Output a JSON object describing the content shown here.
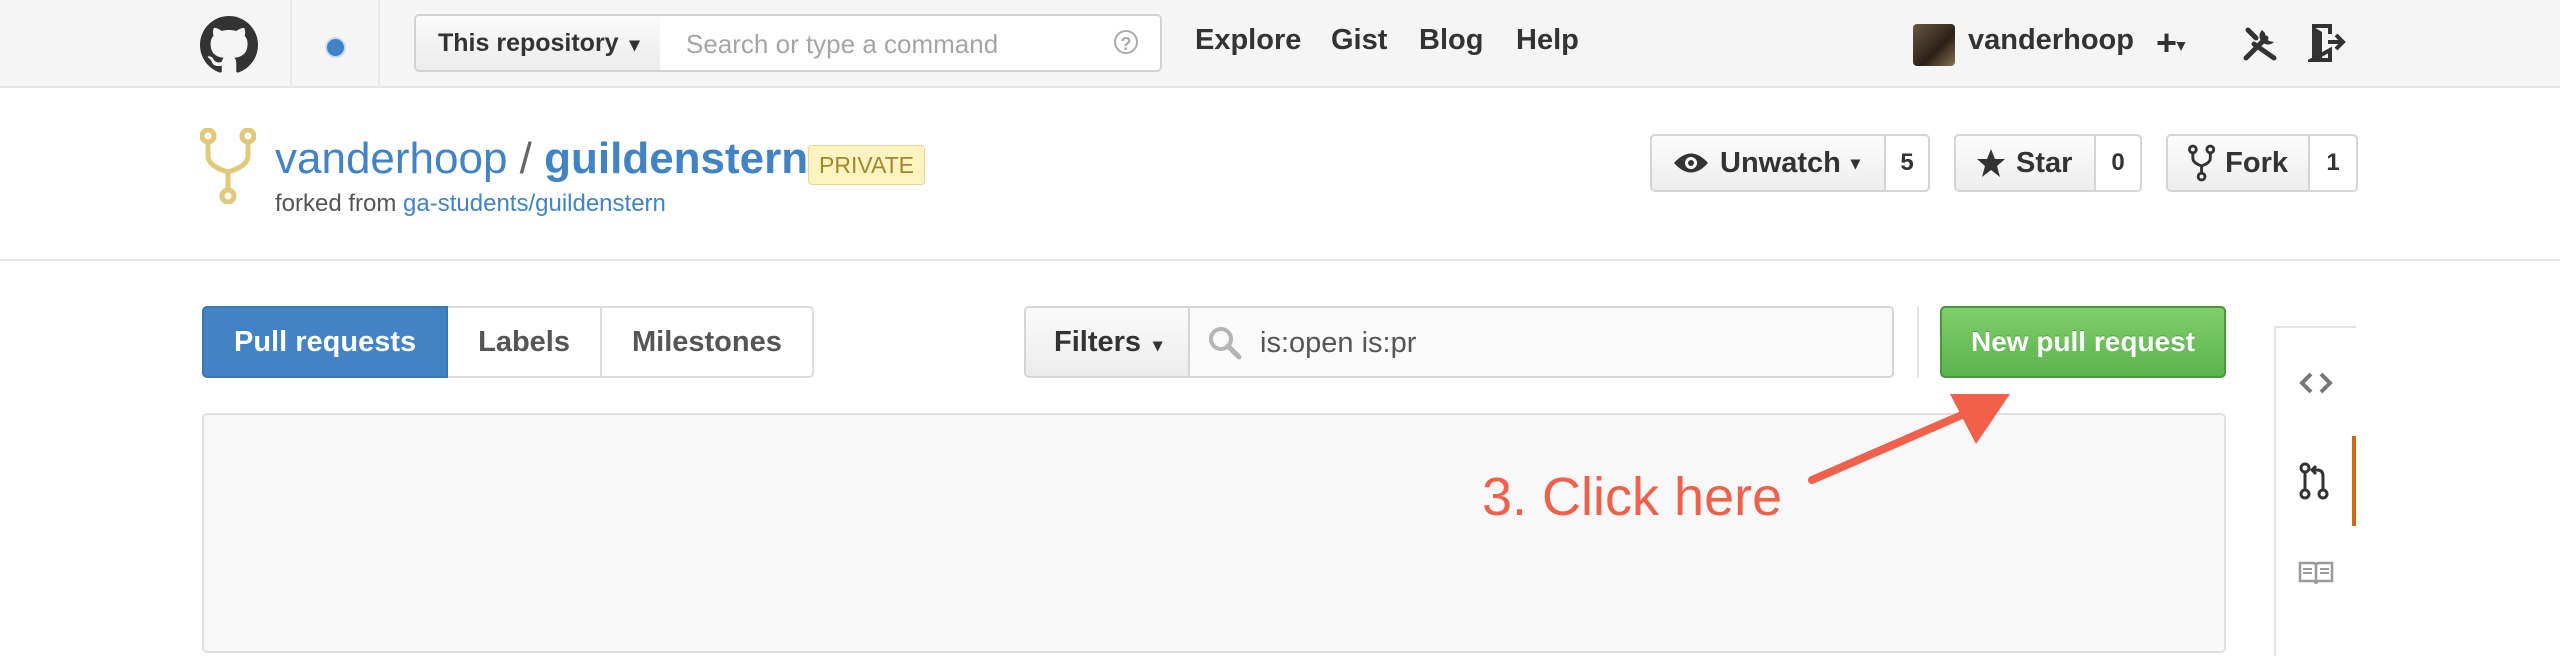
{
  "header": {
    "search_scope_label": "This repository",
    "search_placeholder": "Search or type a command",
    "help_glyph": "?",
    "nav": [
      "Explore",
      "Gist",
      "Blog",
      "Help"
    ],
    "username": "vanderhoop",
    "plus_glyph": "+",
    "caret_glyph": "▾"
  },
  "repo": {
    "owner": "vanderhoop",
    "separator": "/",
    "name": "guildenstern",
    "badge": "PRIVATE",
    "forked_prefix": "forked from ",
    "forked_link": "ga-students/guildenstern",
    "watch_label": "Unwatch",
    "watch_count": "5",
    "star_label": "Star",
    "star_count": "0",
    "fork_label": "Fork",
    "fork_count": "1"
  },
  "subnav": {
    "items": [
      {
        "label": "Pull requests",
        "selected": true
      },
      {
        "label": "Labels",
        "selected": false
      },
      {
        "label": "Milestones",
        "selected": false
      }
    ],
    "filters_label": "Filters",
    "filter_query": "is:open is:pr",
    "new_pr_label": "New pull request"
  },
  "annotation": {
    "text": "3. Click here",
    "color": "#f0604a"
  },
  "colors": {
    "link_blue": "#4183c4",
    "green_button": "#5cb34d",
    "active_tab_orange": "#d26911"
  }
}
